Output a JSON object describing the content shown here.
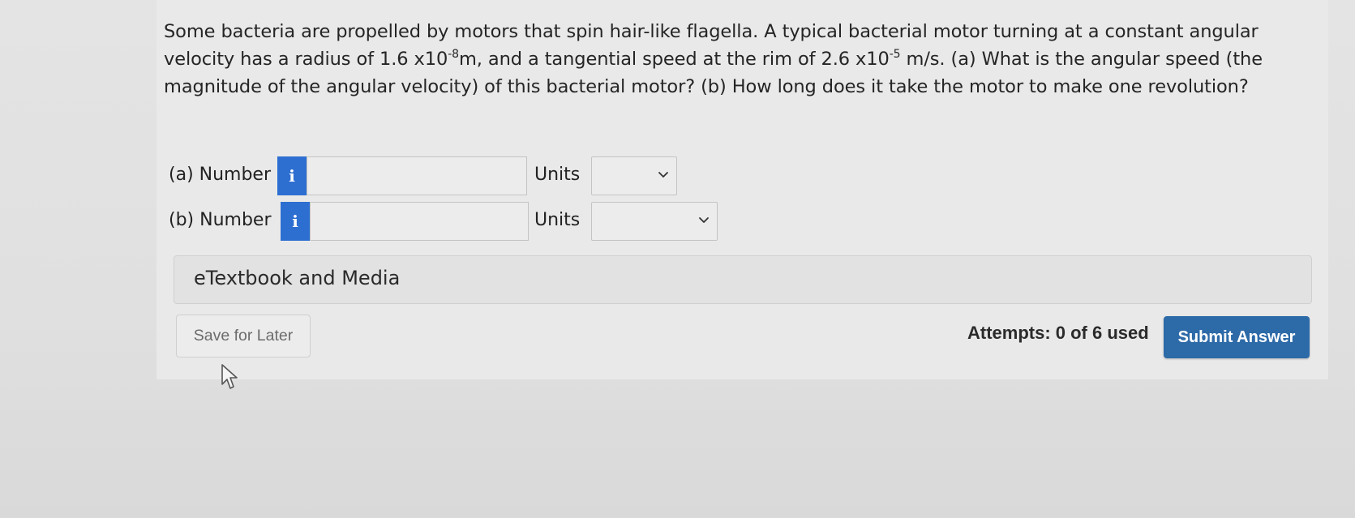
{
  "question": {
    "part1": "Some bacteria are propelled by motors that spin hair-like flagella. A typical bacterial motor turning at a constant angular velocity has a radius of 1.6 x10",
    "radius_exp": "-8",
    "part2": "m, and a tangential speed at the rim of 2.6 x10",
    "speed_exp": "-5",
    "part3": " m/s. (a) What is the angular speed (the magnitude of the angular velocity) of this bacterial motor? (b) How long does it take the motor to make one revolution?"
  },
  "answers": [
    {
      "label": "(a) Number",
      "info_icon_glyph": "i",
      "value": "",
      "units_label": "Units",
      "units_selected": ""
    },
    {
      "label": "(b) Number",
      "info_icon_glyph": "i",
      "value": "",
      "units_label": "Units",
      "units_selected": ""
    }
  ],
  "etextbook": {
    "label": "eTextbook and Media"
  },
  "footer": {
    "save_label": "Save for Later",
    "attempts_text": "Attempts: 0 of 6 used",
    "submit_label": "Submit Answer"
  },
  "colors": {
    "info_blue": "#2d6fd1",
    "submit_blue": "#2d6aa8"
  },
  "icons": {
    "info": "info-icon",
    "dropdown": "chevron-down-icon",
    "cursor": "mouse-pointer-icon"
  }
}
